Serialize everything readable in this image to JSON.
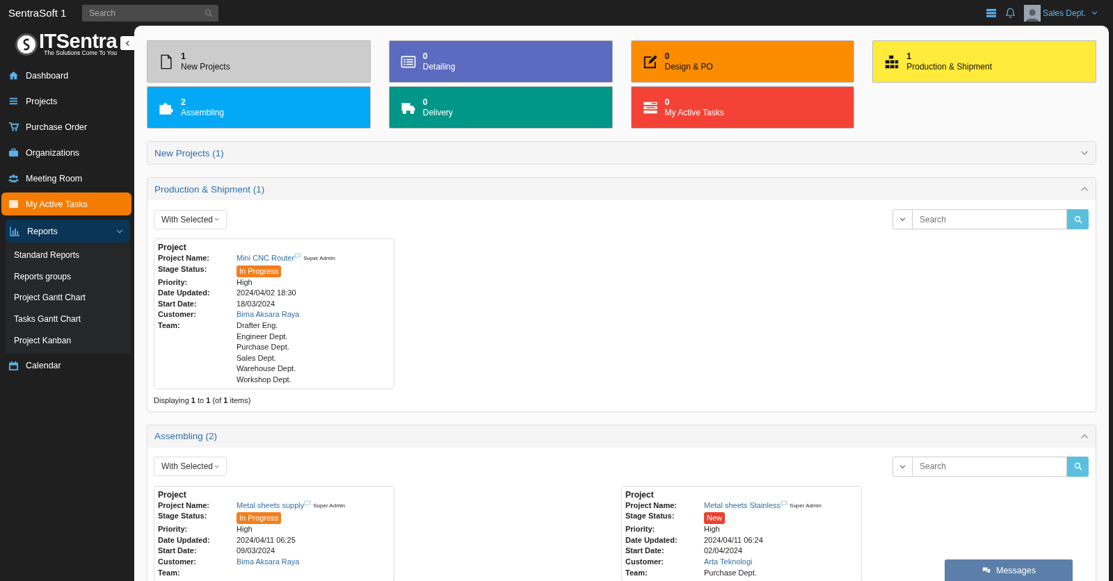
{
  "topbar": {
    "brand": "SentraSoft 1",
    "search": {
      "placeholder": "Search"
    },
    "user": "Sales Dept."
  },
  "sidebar": {
    "logo": {
      "name": "ITSentra",
      "tagline": "The Solutions Come To You"
    },
    "items": [
      {
        "label": "Dashboard",
        "selected": false
      },
      {
        "label": "Projects",
        "selected": false
      },
      {
        "label": "Purchase Order",
        "selected": false
      },
      {
        "label": "Organizations",
        "selected": false
      },
      {
        "label": "Meeting Room",
        "selected": false
      },
      {
        "label": "My Active Tasks",
        "selected": true
      },
      {
        "label": "Reports",
        "selected": false,
        "expanded": true,
        "children": [
          {
            "label": "Standard Reports",
            "selected": false
          },
          {
            "label": "Reports groups",
            "selected": false
          },
          {
            "label": "Project Gantt Chart",
            "selected": false
          },
          {
            "label": "Tasks Gantt Chart",
            "selected": false
          },
          {
            "label": "Project Kanban",
            "selected": false
          }
        ]
      },
      {
        "label": "Calendar",
        "selected": false
      }
    ]
  },
  "tiles": [
    {
      "count": "1",
      "label": "New Projects",
      "color": "#cccccc"
    },
    {
      "count": "0",
      "label": "Detailing",
      "color": "#5c6bc0"
    },
    {
      "count": "0",
      "label": "Design & PO",
      "color": "#fb8c00"
    },
    {
      "count": "1",
      "label": "Production & Shipment",
      "color": "#ffeb3b"
    },
    {
      "count": "2",
      "label": "Assembling",
      "color": "#03a9f4"
    },
    {
      "count": "0",
      "label": "Delivery",
      "color": "#009688"
    },
    {
      "count": "0",
      "label": "My Active Tasks",
      "color": "#f44336"
    }
  ],
  "sections": [
    {
      "title": "New Projects (1)",
      "expanded": false
    },
    {
      "title": "Production & Shipment (1)",
      "expanded": true,
      "bulk_action": "With Selected",
      "search": {
        "placeholder": "Search"
      },
      "cards": [
        {
          "heading": "Project",
          "fields": [
            {
              "kind": "link",
              "label": "Project Name:",
              "value": "Mini CNC Router",
              "note": "Super Admin"
            },
            {
              "kind": "badge",
              "label": "Stage Status:",
              "value": "In Progress",
              "color": "#f0801f"
            },
            {
              "kind": "text",
              "label": "Priority:",
              "value": "High"
            },
            {
              "kind": "text",
              "label": "Date Updated:",
              "value": "2024/04/02 18:30"
            },
            {
              "kind": "text",
              "label": "Start Date:",
              "value": "18/03/2024"
            },
            {
              "kind": "link",
              "label": "Customer:",
              "value": "Bima Aksara Raya"
            },
            {
              "kind": "list",
              "label": "Team:",
              "values": [
                "Drafter Eng.",
                "Engineer Dept.",
                "Purchase Dept.",
                "Sales Dept.",
                "Warehouse Dept.",
                "Workshop Dept."
              ]
            }
          ]
        }
      ],
      "footer": "Displaying **1** to **1** (of **1** items)"
    },
    {
      "title": "Assembling (2)",
      "expanded": true,
      "bulk_action": "With Selected",
      "search": {
        "placeholder": "Search"
      },
      "cards": [
        {
          "heading": "Project",
          "fields": [
            {
              "kind": "link",
              "label": "Project Name:",
              "value": "Metal sheets supply",
              "note": "Super Admin"
            },
            {
              "kind": "badge",
              "label": "Stage Status:",
              "value": "In Progress",
              "color": "#f0801f"
            },
            {
              "kind": "text",
              "label": "Priority:",
              "value": "High"
            },
            {
              "kind": "text",
              "label": "Date Updated:",
              "value": "2024/04/11 06:25"
            },
            {
              "kind": "text",
              "label": "Start Date:",
              "value": "09/03/2024"
            },
            {
              "kind": "link",
              "label": "Customer:",
              "value": "Bima Aksara Raya"
            },
            {
              "kind": "list",
              "label": "Team:"
            }
          ]
        },
        {
          "heading": "Project",
          "fields": [
            {
              "kind": "link",
              "label": "Project Name:",
              "value": "Metal sheets Stainless",
              "note": "Super Admin"
            },
            {
              "kind": "badge",
              "label": "Stage Status:",
              "value": "New",
              "color": "#e8412f"
            },
            {
              "kind": "text",
              "label": "Priority:",
              "value": "High"
            },
            {
              "kind": "text",
              "label": "Date Updated:",
              "value": "2024/04/11 06:24"
            },
            {
              "kind": "text",
              "label": "Start Date:",
              "value": "02/04/2024"
            },
            {
              "kind": "link",
              "label": "Customer:",
              "value": "Arta Teknologi"
            },
            {
              "kind": "list",
              "label": "Team:",
              "values": [
                "Purchase Dept."
              ]
            }
          ]
        }
      ]
    }
  ],
  "messages_button": "Messages"
}
